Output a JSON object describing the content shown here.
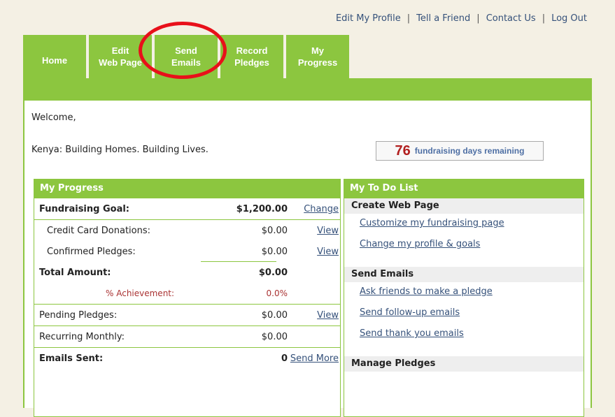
{
  "toplinks": [
    "Edit My Profile",
    "Tell a Friend",
    "Contact Us",
    "Log Out"
  ],
  "tabs": [
    {
      "l1": "Home",
      "l2": ""
    },
    {
      "l1": "Edit",
      "l2": "Web Page"
    },
    {
      "l1": "Send",
      "l2": "Emails"
    },
    {
      "l1": "Record",
      "l2": "Pledges"
    },
    {
      "l1": "My",
      "l2": "Progress"
    }
  ],
  "welcome": "Welcome,",
  "tagline": "Kenya: Building Homes. Building Lives.",
  "days": {
    "count": "76",
    "label": "fundraising days remaining"
  },
  "progress": {
    "title": "My Progress",
    "goal": {
      "label": "Fundraising Goal:",
      "value": "$1,200.00",
      "link": "Change"
    },
    "credit": {
      "label": "Credit Card Donations:",
      "value": "$0.00",
      "link": "View"
    },
    "confirmed": {
      "label": "Confirmed Pledges:",
      "value": "$0.00",
      "link": "View"
    },
    "total": {
      "label": "Total Amount:",
      "value": "$0.00"
    },
    "achievement": {
      "label": "% Achievement:",
      "value": "0.0%"
    },
    "pending": {
      "label": "Pending Pledges:",
      "value": "$0.00",
      "link": "View"
    },
    "recurring": {
      "label": "Recurring Monthly:",
      "value": "$0.00"
    },
    "emails": {
      "label": "Emails Sent:",
      "value": "0",
      "link": "Send More"
    }
  },
  "todo": {
    "title": "My To Do List",
    "sec1": "Create Web Page",
    "link1": "Customize my fundraising page",
    "link2": "Change my profile & goals",
    "sec2": "Send Emails",
    "link3": "Ask friends to make a pledge",
    "link4": "Send follow-up emails",
    "link5": "Send thank you emails",
    "sec3": "Manage Pledges"
  },
  "colors": {
    "green": "#8cc63f",
    "link": "#35517a",
    "highlight": "#e8101a"
  }
}
